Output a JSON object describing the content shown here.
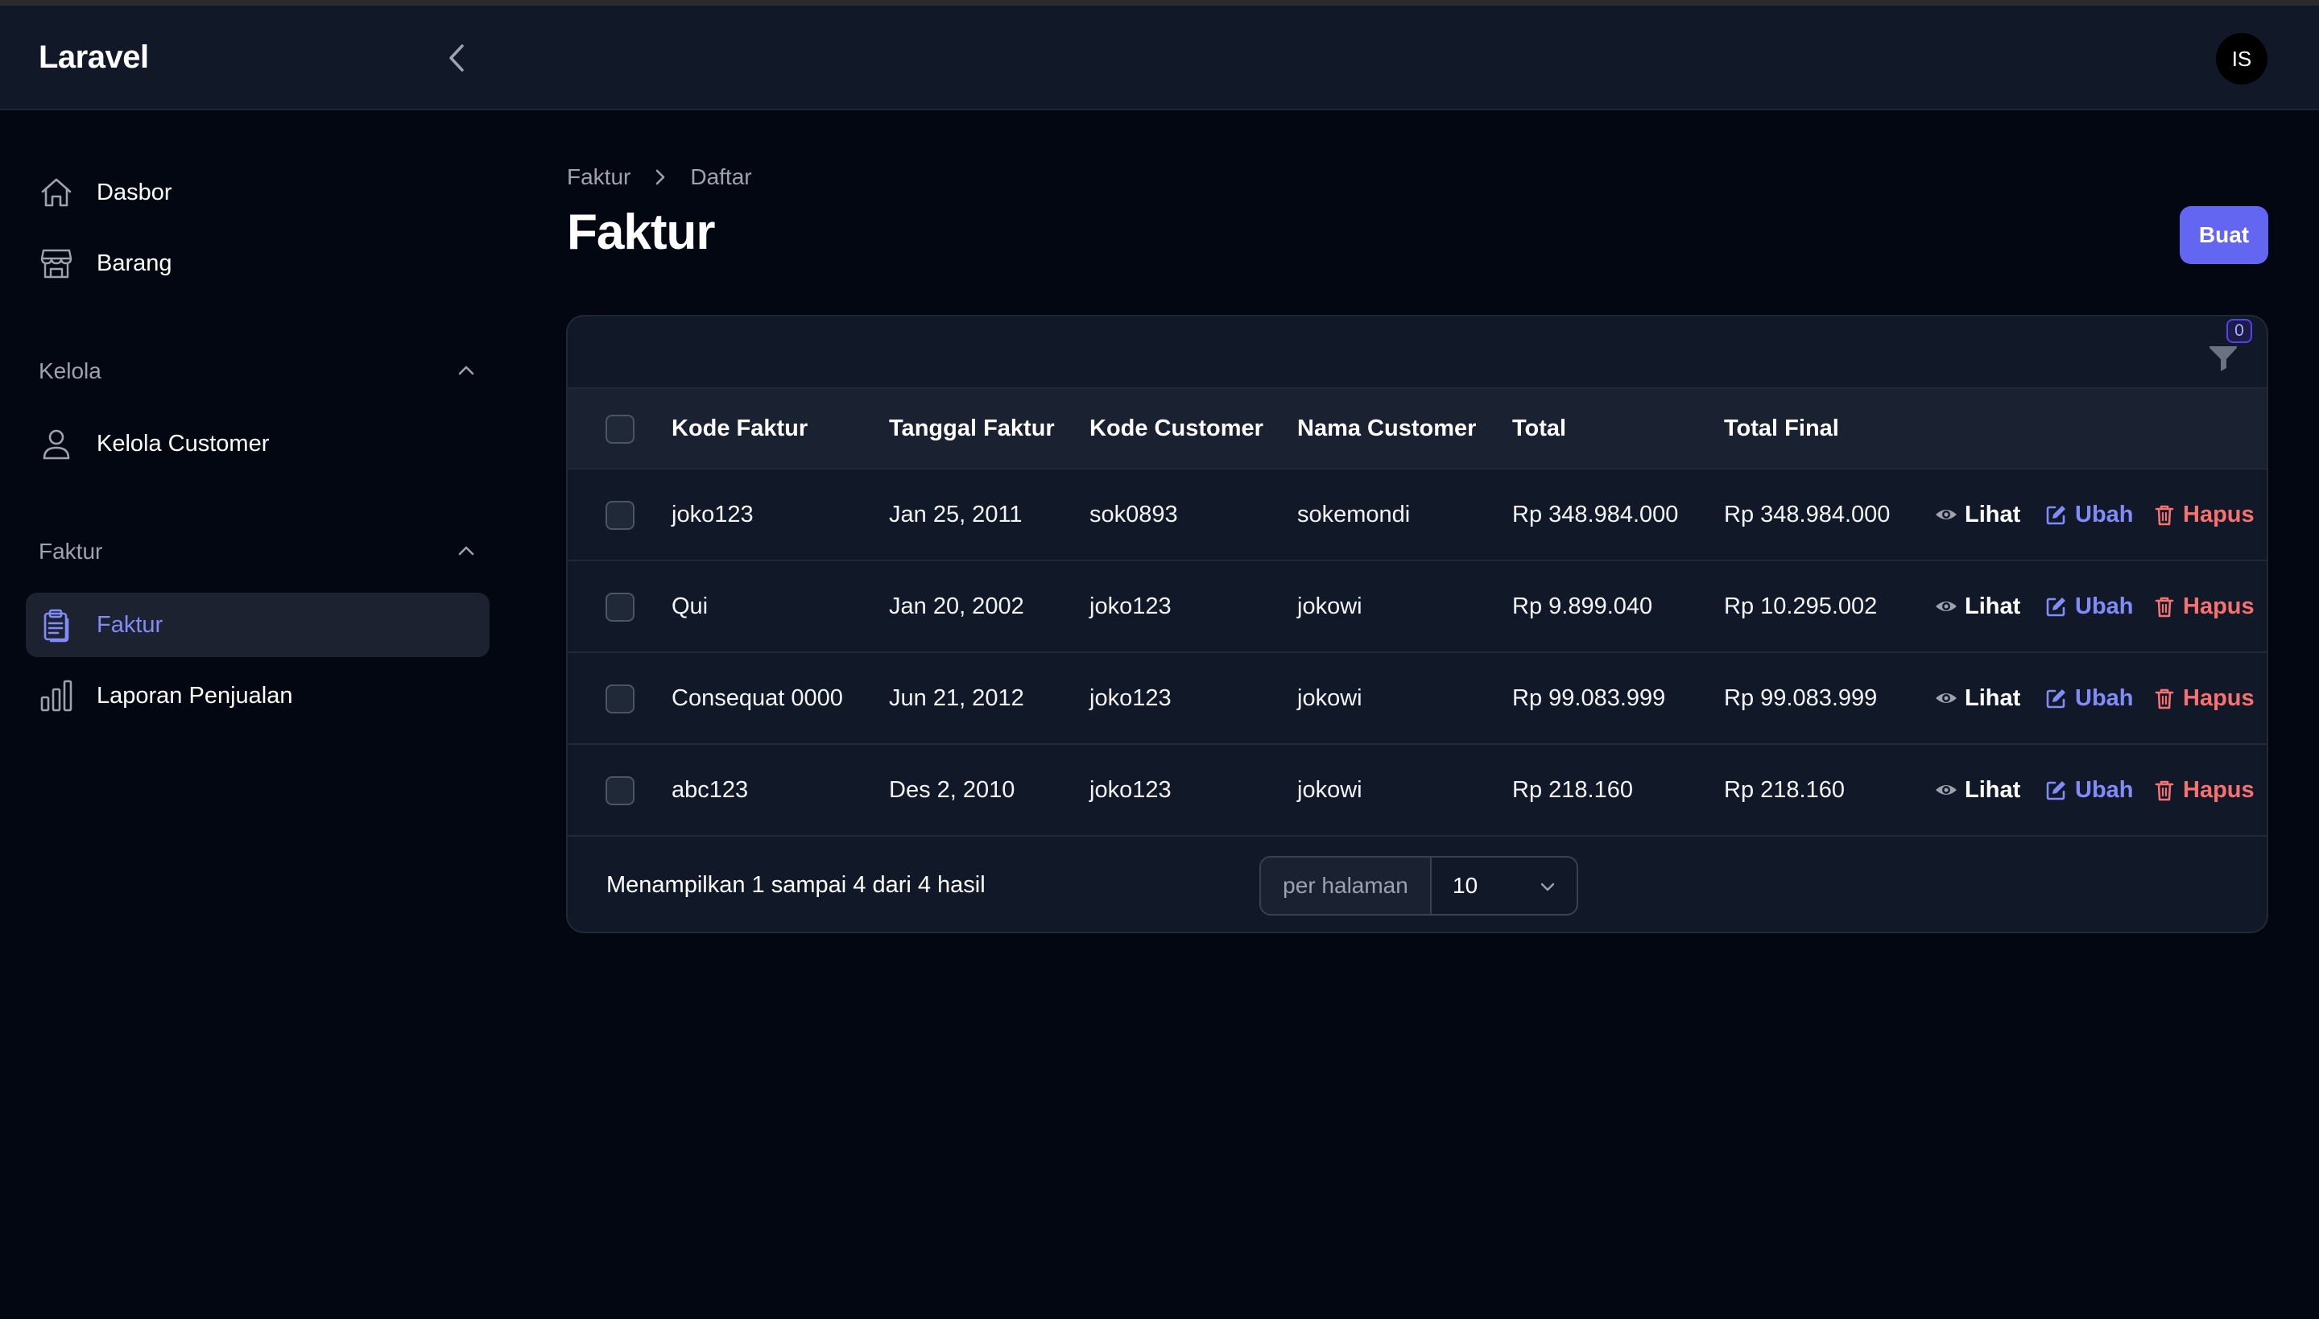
{
  "app": {
    "brand": "Laravel",
    "user_initials": "IS"
  },
  "sidebar": {
    "items": [
      {
        "label": "Dasbor",
        "icon": "home-icon"
      },
      {
        "label": "Barang",
        "icon": "store-icon"
      }
    ],
    "groups": [
      {
        "label": "Kelola",
        "items": [
          {
            "label": "Kelola Customer",
            "icon": "user-icon"
          }
        ]
      },
      {
        "label": "Faktur",
        "items": [
          {
            "label": "Faktur",
            "icon": "clipboard-icon",
            "active": true
          },
          {
            "label": "Laporan Penjualan",
            "icon": "bar-chart-icon"
          }
        ]
      }
    ]
  },
  "breadcrumb": {
    "parent": "Faktur",
    "current": "Daftar"
  },
  "page": {
    "title": "Faktur",
    "create_label": "Buat"
  },
  "filter": {
    "count": "0"
  },
  "table": {
    "columns": [
      "Kode Faktur",
      "Tanggal Faktur",
      "Kode Customer",
      "Nama Customer",
      "Total",
      "Total Final"
    ],
    "actions": {
      "view": "Lihat",
      "edit": "Ubah",
      "delete": "Hapus"
    },
    "rows": [
      [
        "joko123",
        "Jan 25, 2011",
        "sok0893",
        "sokemondi",
        "Rp 348.984.000",
        "Rp 348.984.000"
      ],
      [
        "Qui",
        "Jan 20, 2002",
        "joko123",
        "jokowi",
        "Rp 9.899.040",
        "Rp 10.295.002"
      ],
      [
        "Consequat 0000",
        "Jun 21, 2012",
        "joko123",
        "jokowi",
        "Rp 99.083.999",
        "Rp 99.083.999"
      ],
      [
        "abc123",
        "Des 2, 2010",
        "joko123",
        "jokowi",
        "Rp 218.160",
        "Rp 218.160"
      ]
    ]
  },
  "pagination": {
    "summary": "Menampilkan 1 sampai 4 dari 4 hasil",
    "per_page_label": "per halaman",
    "per_page_value": "10"
  },
  "colors": {
    "accent": "#6366f1",
    "accent_text": "#818cf8",
    "danger": "#f87171",
    "background": "#030712",
    "surface": "#111827"
  }
}
